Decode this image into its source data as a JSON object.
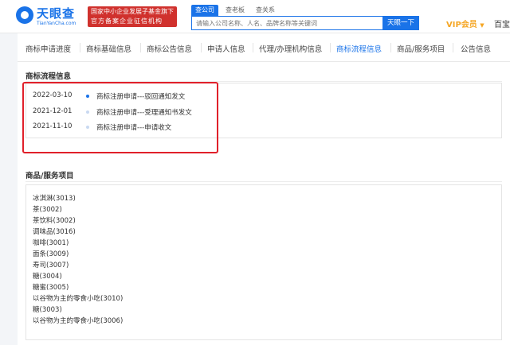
{
  "header": {
    "logo_name": "天眼查",
    "logo_sub": "TianYanCha.com",
    "badge_line1": "国家中小企业发展子基金旗下",
    "badge_line2": "官方备案企业征信机构",
    "search_tabs": [
      "查公司",
      "查老板",
      "查关系"
    ],
    "search_placeholder": "请输入公司名称、人名、品牌名称等关键词",
    "search_button": "天眼一下",
    "vip_label": "VIP会员",
    "right_link": "百宝"
  },
  "nav": {
    "items": [
      "商标申请进度",
      "商标基础信息",
      "商标公告信息",
      "申请人信息",
      "代理/办理机构信息",
      "商标流程信息",
      "商品/服务项目",
      "公告信息"
    ],
    "active_index": 5
  },
  "flow": {
    "title": "商标流程信息",
    "entries": [
      {
        "date": "2022-03-10",
        "text": "商标注册申请---驳回通知发文"
      },
      {
        "date": "2021-12-01",
        "text": "商标注册申请---受理通知书发文"
      },
      {
        "date": "2021-11-10",
        "text": "商标注册申请---申请收文"
      }
    ]
  },
  "goods": {
    "title": "商品/服务项目",
    "items": [
      "冰淇淋(3013)",
      "茶(3002)",
      "茶饮料(3002)",
      "调味品(3016)",
      "咖啡(3001)",
      "面条(3009)",
      "寿司(3007)",
      "糖(3004)",
      "糖蜜(3005)",
      "以谷物为主的零食小吃(3010)",
      "糖(3003)",
      "以谷物为主的零食小吃(3006)"
    ]
  },
  "colors": {
    "accent": "#1a73e8",
    "highlight": "#e0202a",
    "vip": "#f5a623",
    "badge": "#d0312d"
  }
}
